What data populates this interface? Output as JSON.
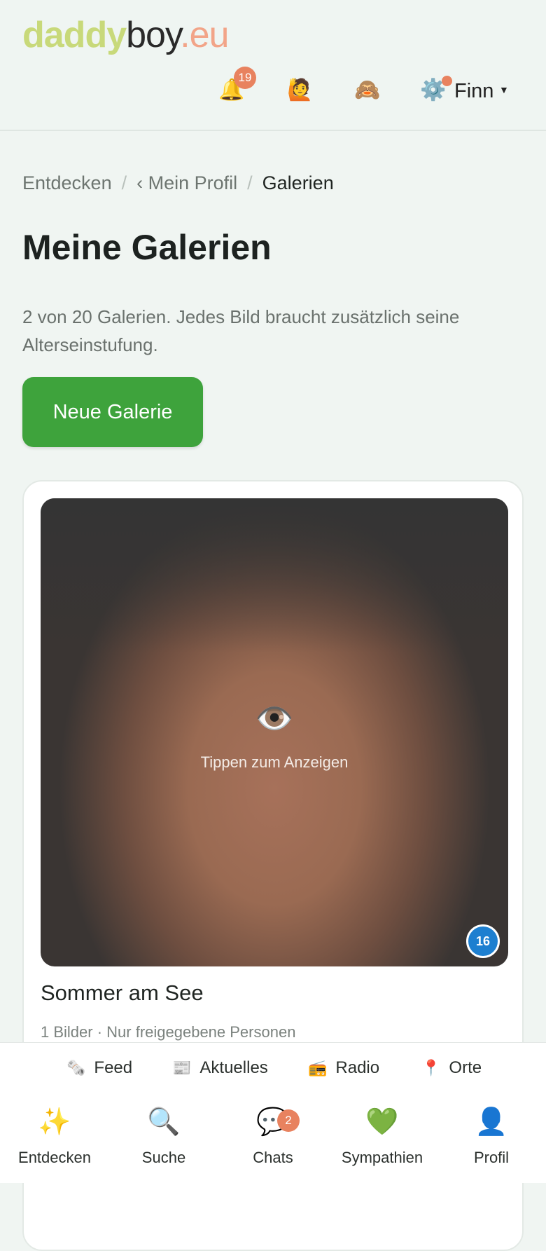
{
  "brand": {
    "part1": "daddy",
    "part2": "boy",
    "part3": ".eu"
  },
  "header": {
    "notifications_count": "19",
    "user_name": "Finn",
    "icons": [
      "bell-icon",
      "person-raising-hand-icon",
      "see-no-evil-monkey-icon",
      "gear-icon"
    ]
  },
  "breadcrumb": {
    "home": "Entdecken",
    "profile": "‹ Mein Profil",
    "current": "Galerien",
    "separator": "/"
  },
  "page": {
    "title": "Meine Galerien",
    "description": "2 von 20 Galerien. Jedes Bild braucht zusätzlich seine Alterseinstufung.",
    "new_button": "Neue Galerie"
  },
  "gallery": {
    "eye_icon": "👁️",
    "hint": "Tippen zum Anzeigen",
    "badge": "16",
    "name": "Sommer am See",
    "meta": "1 Bilder · Nur freigegebene Personen"
  },
  "subnav": [
    {
      "label": "Feed",
      "icon": "🗞️"
    },
    {
      "label": "Aktuelles",
      "icon": "📰"
    },
    {
      "label": "Radio",
      "icon": "📻"
    },
    {
      "label": "Orte",
      "icon": "📍"
    }
  ],
  "tabs": [
    {
      "label": "Entdecken",
      "icon": "✨"
    },
    {
      "label": "Suche",
      "icon": "🔍"
    },
    {
      "label": "Chats",
      "icon": "💬",
      "badge": "2"
    },
    {
      "label": "Sympathien",
      "icon": "💚"
    },
    {
      "label": "Profil",
      "icon": "👤"
    }
  ],
  "colors": {
    "accent_green": "#3ea33c",
    "badge_orange": "#e8825f",
    "count_blue": "#1d7fd0"
  }
}
